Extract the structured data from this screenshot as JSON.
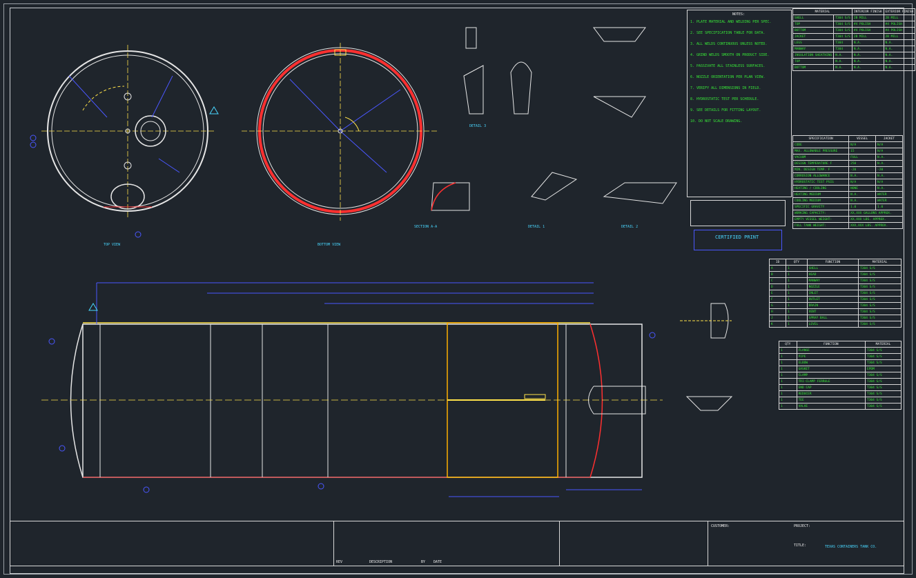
{
  "drawing": {
    "notes_title": "NOTES:",
    "notes": [
      "1. PLATE MATERIAL AND WELDING PER SPEC.",
      "2. SEE SPECIFICATION TABLE FOR DATA.",
      "3. ALL WELDS CONTINUOUS UNLESS NOTED.",
      "4. GRIND WELDS SMOOTH ON PRODUCT SIDE.",
      "5. PASSIVATE ALL STAINLESS SURFACES.",
      "6. NOZZLE ORIENTATION PER PLAN VIEW.",
      "7. VERIFY ALL DIMENSIONS IN FIELD.",
      "8. HYDROSTATIC TEST PER SCHEDULE.",
      "9. SEE DETAILS FOR FITTING LAYOUT.",
      "10. DO NOT SCALE DRAWING."
    ],
    "material_table": {
      "title": "MATERIAL",
      "col1": "INTERIOR FINISH",
      "col2": "EXTERIOR FINISH",
      "rows": [
        [
          "SHELL",
          "T304 S/S",
          "2B MILL",
          "2B MILL"
        ],
        [
          "TOP",
          "T304 S/S",
          "#4 POLISH",
          "#4 POLISH"
        ],
        [
          "BOTTOM",
          "T304 S/S",
          "#4 POLISH",
          "#4 POLISH"
        ],
        [
          "JACKET",
          "T304 S/S",
          "2B MILL",
          "2B MILL"
        ],
        [
          "LEGS",
          "T304",
          "N.A.",
          "N.A."
        ],
        [
          "MANWAY",
          "T304",
          "N.A.",
          "N.A."
        ],
        [
          "INSULATION SHEATHING",
          "N.A.",
          "N.A.",
          "N.A."
        ],
        [
          "TOP",
          "N.A.",
          "N.A.",
          "N.A."
        ],
        [
          "BOTTOM",
          "N.A.",
          "N.A.",
          "N.A."
        ]
      ]
    },
    "spec_table": {
      "title": "SPECIFICATION",
      "col1": "VESSEL",
      "col2": "JACKET",
      "rows": [
        [
          "CODE",
          "N/A",
          "N/A"
        ],
        [
          "MAX. ALLOWABLE PRESSURE",
          "15",
          "N/A"
        ],
        [
          "VACUUM",
          "FULL",
          "N.A."
        ],
        [
          "DESIGN TEMPERATURE F",
          "250",
          "N.A."
        ],
        [
          "MIN. DESIGN TEMP. F",
          "-20",
          "-20"
        ],
        [
          "CORROSION ALLOWANCE",
          "N.A.",
          "N.A."
        ],
        [
          "HYDROSTATIC TEST PSIG",
          "N/A",
          "N/A"
        ],
        [
          "HEATING / COOLING",
          "NONE",
          "N.A."
        ],
        [
          "HEATING MEDIUM",
          "N.A.",
          "WATER"
        ],
        [
          "COOLING MEDIUM",
          "N.A.",
          "WATER"
        ],
        [
          "SPECIFIC GRAVITY",
          "1.0",
          "1.0"
        ]
      ],
      "capacity_label": "WORKING CAPACITY:",
      "capacity_value": "XX,XXX GALLONS APPROX.",
      "empty_label": "EMPTY VESSEL WEIGHT:",
      "empty_value": "XX,XXX LBS. APPROX.",
      "full_label": "FULL TANK WEIGHT:",
      "full_value": "XXX,XXX LBS. APPROX."
    },
    "nozzle_table": {
      "headers": [
        "ID",
        "QTY",
        "FUNCTION",
        "MATERIAL"
      ],
      "rows": [
        [
          "A",
          "1",
          "SHELL",
          "T304 S/S"
        ],
        [
          "B",
          "1",
          "HEAD",
          "T304 S/S"
        ],
        [
          "C",
          "1",
          "MANWAY",
          "T304 S/S"
        ],
        [
          "D",
          "1",
          "NOZZLE",
          "T304 S/S"
        ],
        [
          "E",
          "1",
          "INLET",
          "T304 S/S"
        ],
        [
          "F",
          "1",
          "OUTLET",
          "T304 S/S"
        ],
        [
          "G",
          "1",
          "DRAIN",
          "T304 S/S"
        ],
        [
          "H",
          "1",
          "VENT",
          "T304 S/S"
        ],
        [
          "J",
          "1",
          "SPRAY BALL",
          "T304 S/S"
        ],
        [
          "K",
          "1",
          "LEVEL",
          "T304 S/S"
        ]
      ]
    },
    "fitting_table": {
      "headers": [
        "QTY",
        "FUNCTION",
        "MATERIAL"
      ],
      "rows": [
        [
          "1",
          "FLANGE",
          "T304 S/S"
        ],
        [
          "1",
          "PIPE",
          "T304 S/S"
        ],
        [
          "1",
          "ELBOW",
          "T304 S/S"
        ],
        [
          "1",
          "GASKET",
          "EPDM"
        ],
        [
          "1",
          "CLAMP",
          "T304 S/S"
        ],
        [
          "1",
          "TRI-CLAMP FERRULE",
          "T304 S/S"
        ],
        [
          "1",
          "END CAP",
          "T304 S/S"
        ],
        [
          "1",
          "REDUCER",
          "T304 S/S"
        ],
        [
          "1",
          "TEE",
          "T304 S/S"
        ],
        [
          "1",
          "VALVE",
          "T304 S/S"
        ]
      ]
    },
    "stamp_title": "CERTIFIED PRINT",
    "title_block": {
      "customer_label": "CUSTOMER:",
      "project_label": "PROJECT:",
      "title_label": "TITLE:",
      "company": "TEXAS CONTAINERS TANK CO.",
      "rev_label": "REV",
      "description_label": "DESCRIPTION",
      "date_label": "DATE",
      "by_label": "BY"
    },
    "view_labels": {
      "top_view": "TOP VIEW",
      "bottom_view": "BOTTOM VIEW",
      "section_a": "SECTION A-A",
      "detail_1": "DETAIL 1",
      "detail_2": "DETAIL 2",
      "detail_3": "DETAIL 3"
    },
    "colors": {
      "background": "#1f252c",
      "line": "#e6e6e6",
      "center": "#ffe24a",
      "dim": "#4a57ff",
      "weld": "#ff3030",
      "text": "#38e838",
      "accent": "#49d7ff"
    }
  }
}
